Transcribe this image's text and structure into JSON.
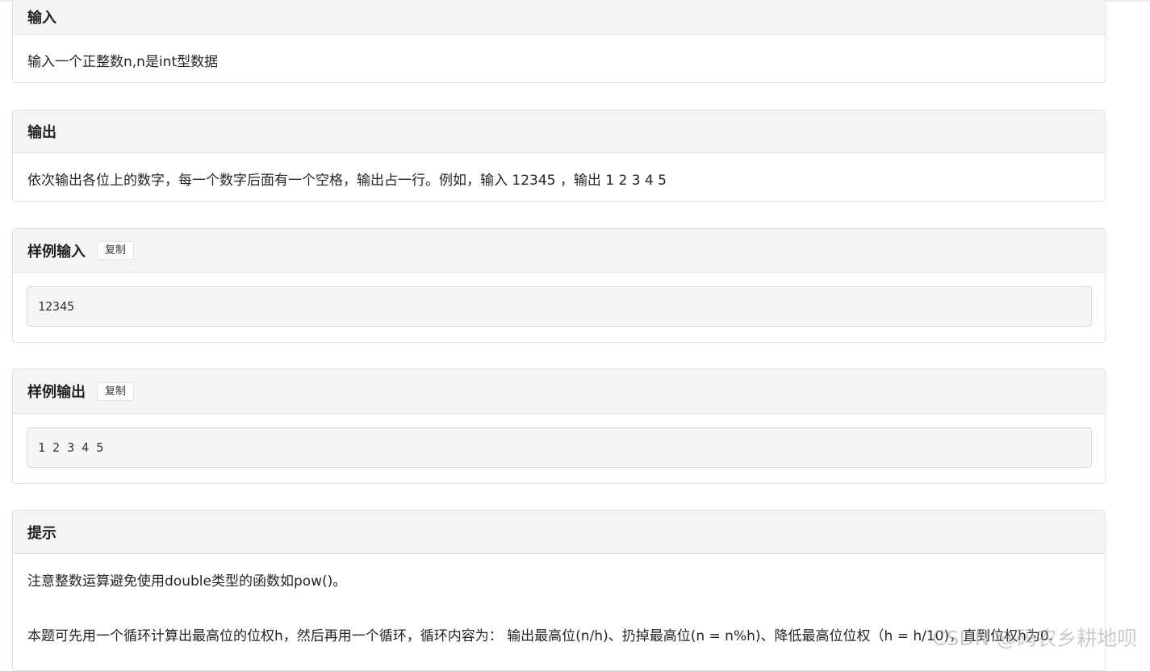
{
  "sections": {
    "input": {
      "title": "输入",
      "body": "输入一个正整数n,n是int型数据"
    },
    "output": {
      "title": "输出",
      "body": "依次输出各位上的数字，每一个数字后面有一个空格，输出占一行。例如，输入 12345 ，输出 1 2 3 4 5"
    },
    "sample_input": {
      "title": "样例输入",
      "copy_label": "复制",
      "content": "12345"
    },
    "sample_output": {
      "title": "样例输出",
      "copy_label": "复制",
      "content": "1 2 3 4 5"
    },
    "hint": {
      "title": "提示",
      "line1": "注意整数运算避免使用double类型的函数如pow()。",
      "line2": "本题可先用一个循环计算出最高位的位权h，然后再用一个循环，循环内容为： 输出最高位(n/h)、扔掉最高位(n = n%h)、降低最高位位权（h = h/10)，直到位权h为0."
    }
  },
  "watermark": "CSDN @码农乡耕地呗"
}
